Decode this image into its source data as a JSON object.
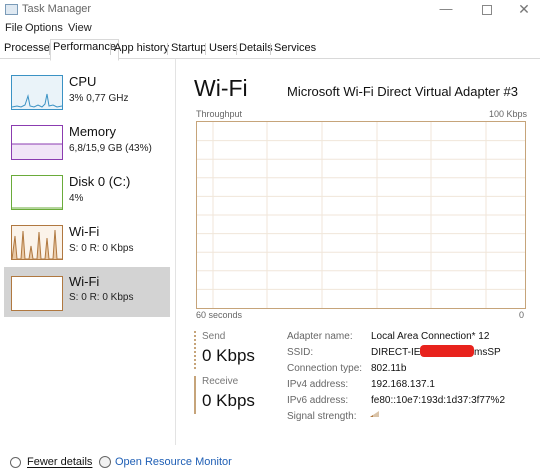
{
  "window": {
    "title": "Task Manager"
  },
  "menu": [
    "File",
    "Options",
    "View"
  ],
  "tabs": [
    "Processes",
    "Performance",
    "App history",
    "Startup",
    "Users",
    "Details",
    "Services"
  ],
  "sidebar": [
    {
      "title": "CPU",
      "sub": "3%  0,77 GHz",
      "color": "#3b92c4"
    },
    {
      "title": "Memory",
      "sub": "6,8/15,9 GB (43%)",
      "color": "#8b3cb0"
    },
    {
      "title": "Disk 0 (C:)",
      "sub": "4%",
      "color": "#6aab3a"
    },
    {
      "title": "Wi-Fi",
      "sub": "S: 0  R: 0 Kbps",
      "color": "#b07840"
    },
    {
      "title": "Wi-Fi",
      "sub": "S: 0  R: 0 Kbps",
      "color": "#b07840"
    }
  ],
  "main": {
    "title": "Wi-Fi",
    "adapter": "Microsoft Wi-Fi Direct Virtual Adapter #3",
    "graph": {
      "top_left": "Throughput",
      "top_right": "100 Kbps",
      "bottom_left": "60 seconds",
      "bottom_right": "0",
      "line_color": "#c6a47a"
    },
    "send": {
      "label": "Send",
      "value": "0 Kbps"
    },
    "receive": {
      "label": "Receive",
      "value": "0 Kbps"
    },
    "properties": [
      {
        "label": "Adapter name:",
        "value": "Local Area Connection* 12"
      },
      {
        "label": "SSID:",
        "value": "DIRECT-IE"
      },
      {
        "label": "Connection type:",
        "value": "802.11b"
      },
      {
        "label": "IPv4 address:",
        "value": "192.168.137.1"
      },
      {
        "label": "IPv6 address:",
        "value": "fe80::10e7:193d:1d37:3f77%2"
      },
      {
        "label": "Signal strength:",
        "value": ""
      }
    ],
    "ssid_suffix": "msSP"
  },
  "footer": {
    "fewer": "Fewer details",
    "monitor": "Open Resource Monitor"
  }
}
